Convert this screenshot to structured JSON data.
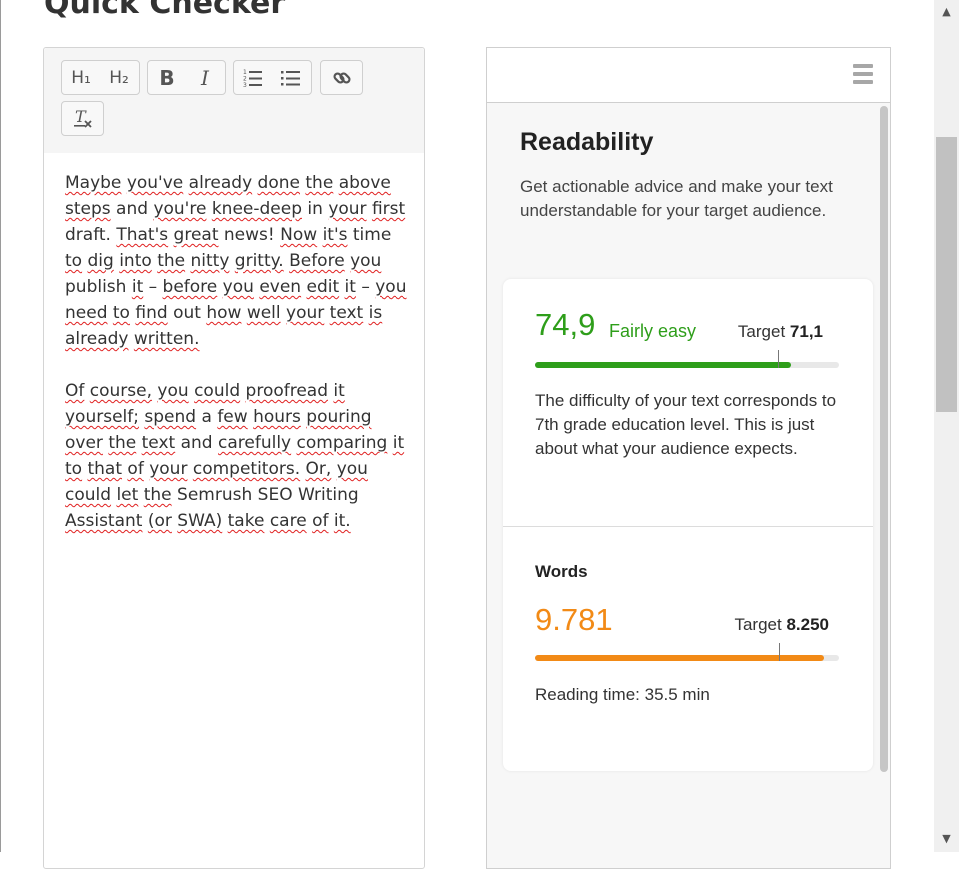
{
  "page": {
    "title": "Quick Checker"
  },
  "toolbar": {
    "h1": "H₁",
    "h2": "H₂",
    "bold": "B",
    "italic": "I",
    "icons": [
      "heading-1-icon",
      "heading-2-icon",
      "bold-icon",
      "italic-icon",
      "ordered-list-icon",
      "bullet-list-icon",
      "link-icon",
      "clear-format-icon"
    ]
  },
  "editor": {
    "paragraph1": "Maybe you've already done the above steps and you're knee-deep in your first draft. That's great news! Now it's time to dig into the nitty gritty. Before you publish it – before you even edit it – you need to find out how well your text is already written.",
    "paragraph2": "Of course, you could proofread it yourself; spend a few hours pouring over the text and carefully comparing it to that of your competitors. Or, you could let the Semrush SEO Writing Assistant (or SWA) take care of it."
  },
  "panel": {
    "title": "Readability",
    "description": "Get actionable advice and make your text understandable for your target audience.",
    "readability": {
      "score": "74,9",
      "label": "Fairly easy",
      "target_label": "Target",
      "target_value": "71,1",
      "progress": 0.843,
      "target_position": 0.8,
      "color": "#2e9e1a",
      "note": "The difficulty of your text corresponds to 7th grade education level. This is just about what your audience expects."
    },
    "words": {
      "title": "Words",
      "value": "9.781",
      "target_label": "Target",
      "target_value": "8.250",
      "progress": 0.95,
      "target_position": 0.803,
      "color": "#f28a16",
      "reading_time": "Reading time: 35.5 min"
    }
  }
}
